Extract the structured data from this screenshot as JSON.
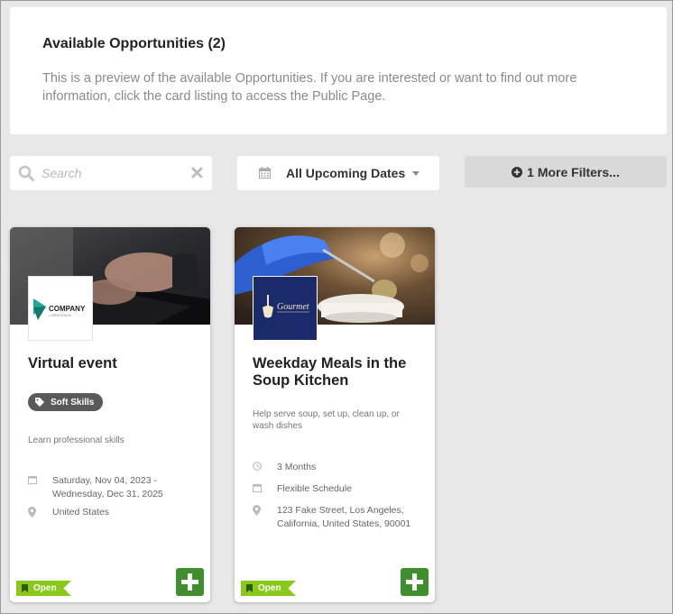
{
  "header": {
    "title": "Available Opportunities (2)",
    "description": "This is a preview of the available Opportunities. If you are interested or want to find out more information, click the card listing to access the Public Page."
  },
  "search": {
    "placeholder": "Search",
    "value": ""
  },
  "date_filter": {
    "selected": "All Upcoming Dates"
  },
  "more_filters": {
    "label": "1 More Filters..."
  },
  "cards": [
    {
      "title": "Virtual event",
      "logo_text": "COMPANY",
      "logo_subtext": "LOREM IPSUM",
      "tag": "Soft Skills",
      "description": "Learn professional skills",
      "date": "Saturday, Nov 04, 2023 - Wednesday, Dec 31, 2025",
      "location": "United States",
      "status": "Open"
    },
    {
      "title": "Weekday Meals in the Soup Kitchen",
      "logo_text": "Gourmet",
      "description": "Help serve soup, set up, clean up, or wash dishes",
      "duration": "3 Months",
      "schedule": "Flexible Schedule",
      "location": "123 Fake Street, Los Angeles, California, United States, 90001",
      "status": "Open"
    }
  ],
  "icons": {
    "search": "search-icon",
    "clear": "close-icon",
    "calendar": "calendar-icon",
    "caret": "caret-down-icon",
    "add_filter": "plus-circle-icon",
    "tag": "tag-icon",
    "location": "map-pin-icon",
    "clock": "clock-icon",
    "flag": "bookmark-icon",
    "add": "plus-icon"
  },
  "colors": {
    "status_open": "#8ac81a",
    "add_button": "#3f8f2e",
    "logo_teal": "#1fa79a",
    "gourmet_navy": "#1b2a6a"
  }
}
